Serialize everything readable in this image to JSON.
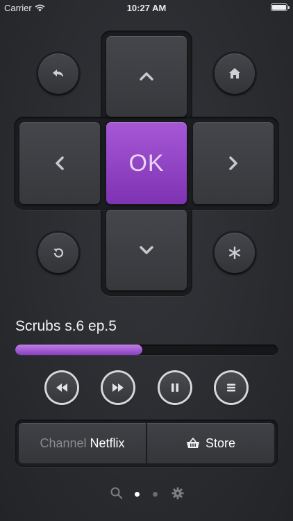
{
  "status_bar": {
    "carrier": "Carrier",
    "time": "10:27 AM"
  },
  "now_playing": {
    "title": "Scrubs s.6 ep.5",
    "progress": 0.485
  },
  "dpad": {
    "ok_label": "OK"
  },
  "bottom_bar": {
    "channel_label": "Channel",
    "channel_value": "Netflix",
    "store_label": "Store"
  },
  "pager": {
    "active_index": 0,
    "page_count": 2
  },
  "colors": {
    "accent": "#9b4fd0",
    "background": "#2b2c30"
  }
}
